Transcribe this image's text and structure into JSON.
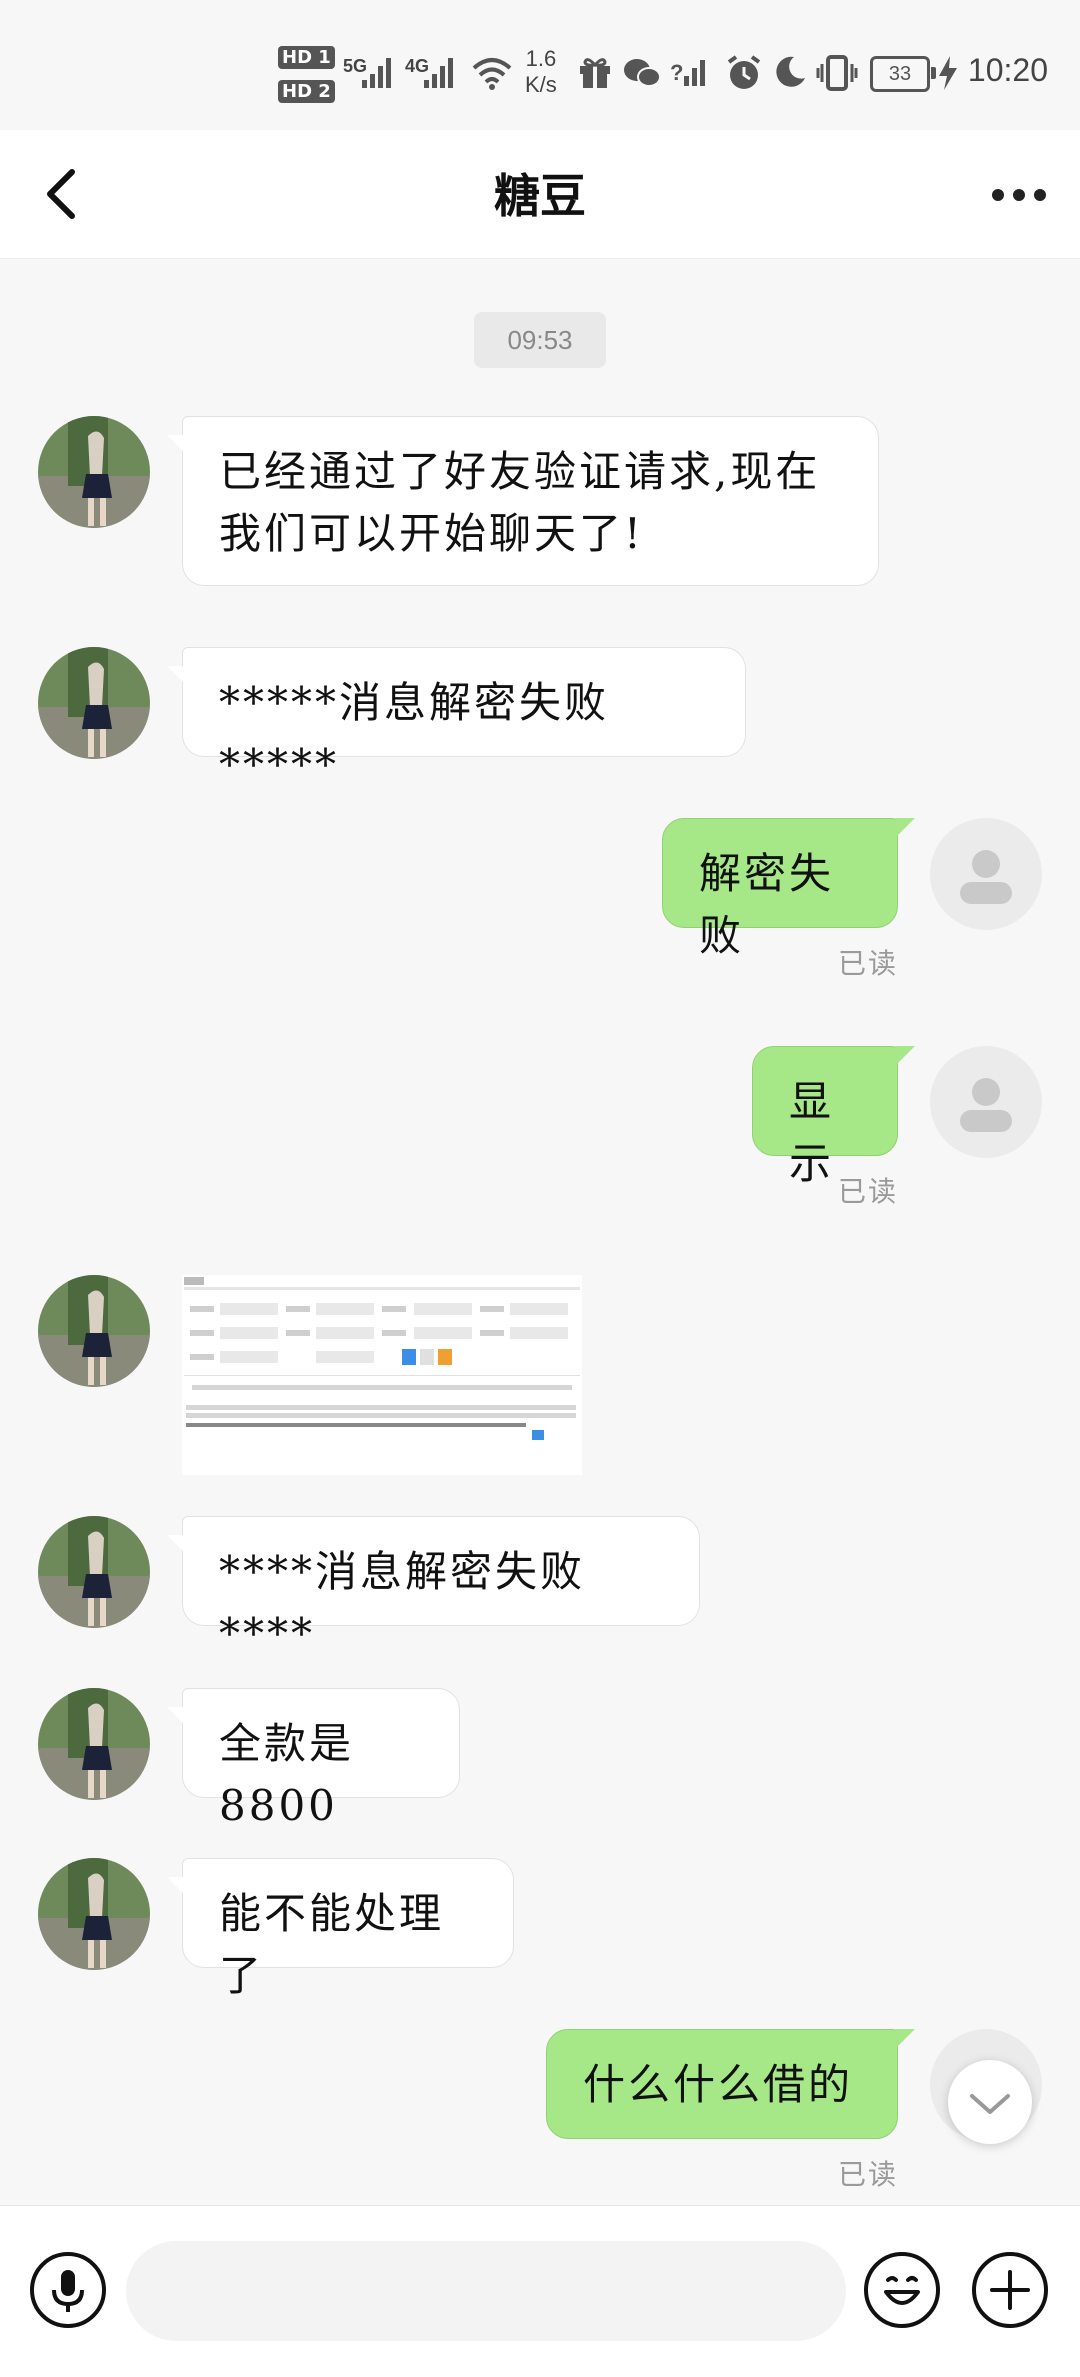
{
  "status_bar": {
    "hd1": "HD 1",
    "hd2": "HD 2",
    "net1": "5G",
    "net2": "4G",
    "speed_value": "1.6",
    "speed_unit": "K/s",
    "battery": "33",
    "time": "10:20",
    "icons": [
      "signal-icon",
      "wifi-icon",
      "gift-icon",
      "wechat-icon",
      "no-signal-icon",
      "alarm-icon",
      "moon-icon",
      "vibrate-icon",
      "battery-icon",
      "charging-icon"
    ]
  },
  "header": {
    "title": "糖豆",
    "back_icon": "chevron-left-icon",
    "more_icon": "more-dots-icon"
  },
  "chat": {
    "timestamp": "09:53",
    "messages": [
      {
        "side": "left",
        "type": "text",
        "text_line1": "已经通过了好友验证请求,现在",
        "text_line2": "我们可以开始聊天了!"
      },
      {
        "side": "left",
        "type": "text",
        "text": "*****消息解密失败*****"
      },
      {
        "side": "right",
        "type": "text",
        "text": "解密失败",
        "status": "已读"
      },
      {
        "side": "right",
        "type": "text",
        "text": "显示",
        "status": "已读"
      },
      {
        "side": "left",
        "type": "image",
        "thumbnail": "screenshot-thumbnail"
      },
      {
        "side": "left",
        "type": "text",
        "text": "****消息解密失败****"
      },
      {
        "side": "left",
        "type": "text",
        "text": "全款是8800"
      },
      {
        "side": "left",
        "type": "text",
        "text": "能不能处理了"
      },
      {
        "side": "right",
        "type": "text",
        "text": "什么什么借的",
        "status": "已读"
      }
    ]
  },
  "input_bar": {
    "placeholder": "",
    "voice_icon": "microphone-icon",
    "emoji_icon": "emoji-icon",
    "plus_icon": "plus-icon"
  },
  "colors": {
    "sent_bubble": "#a6e788",
    "received_bubble": "#ffffff",
    "background": "#f7f7f7"
  }
}
